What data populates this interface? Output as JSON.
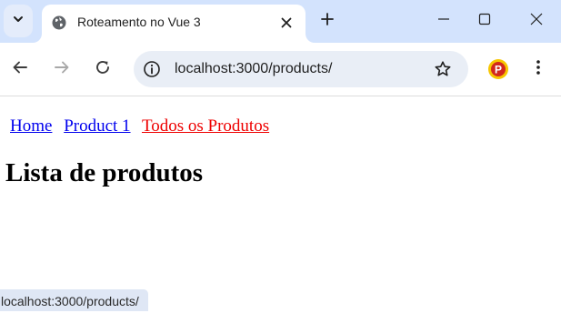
{
  "browser": {
    "tab": {
      "title": "Roteamento no Vue 3"
    },
    "address_bar": {
      "url": "localhost:3000/products/"
    },
    "extension": {
      "letter": "P"
    },
    "status_url": "localhost:3000/products/"
  },
  "page": {
    "nav": {
      "home": "Home",
      "product1": "Product 1",
      "all_products": "Todos os Produtos"
    },
    "heading": "Lista de produtos"
  },
  "colors": {
    "link": "#0000ee",
    "active_link": "#ee0000",
    "tabstrip": "#d3e3fd"
  }
}
